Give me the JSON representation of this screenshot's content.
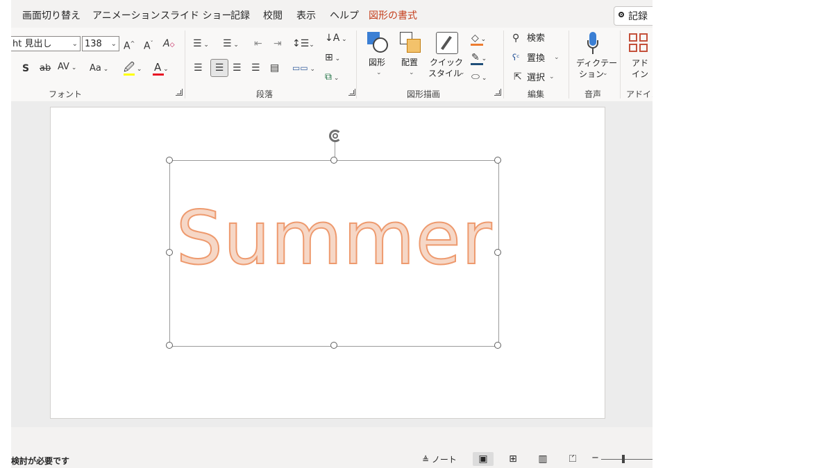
{
  "tabs": [
    {
      "label": "画面切り替え"
    },
    {
      "label": "アニメーション"
    },
    {
      "label": "スライド ショー"
    },
    {
      "label": "記録"
    },
    {
      "label": "校閲"
    },
    {
      "label": "表示"
    },
    {
      "label": "ヘルプ"
    },
    {
      "label": "図形の書式",
      "active": true
    }
  ],
  "record_button": "記録",
  "font_group": {
    "font_name": "ht 見出し",
    "font_size": "138",
    "label": "フォント"
  },
  "paragraph_group": {
    "label": "段落"
  },
  "drawing_group": {
    "label": "図形描画",
    "shapes_label": "図形",
    "arrange_label": "配置",
    "quick_styles_line1": "クイック",
    "quick_styles_line2": "スタイル"
  },
  "editing_group": {
    "label": "編集",
    "find": "検索",
    "replace": "置換",
    "select": "選択"
  },
  "voice_group": {
    "label": "音声",
    "dictate_line1": "ディクテー",
    "dictate_line2": "ション"
  },
  "addin_group": {
    "label": "アドイン",
    "addin_line1": "アド",
    "addin_line2": "イン"
  },
  "slide": {
    "text": "Summer",
    "fill_color": "#f6d7c6",
    "outline_color": "#ee9a6e"
  },
  "status": {
    "message": "検討が必要です",
    "notes": "ノート"
  },
  "colors": {
    "accent_tab": "#c43e1c",
    "highlight_bar": "#ffff00",
    "font_color_bar": "#e81123",
    "fill_bar": "#ed7d31",
    "outline_bar": "#1f4e79"
  }
}
